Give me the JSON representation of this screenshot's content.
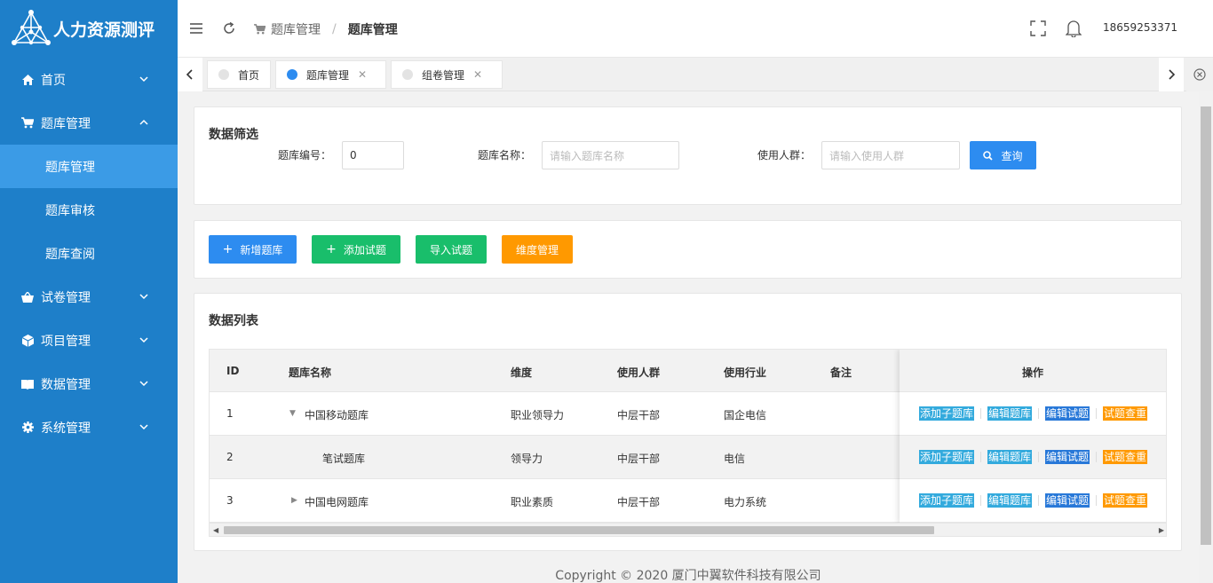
{
  "app": {
    "title": "人力资源测评"
  },
  "sidebar": {
    "items": [
      {
        "label": "首页",
        "icon": "home-icon"
      },
      {
        "label": "题库管理",
        "icon": "cart-icon",
        "expanded": true,
        "children": [
          {
            "label": "题库管理",
            "active": true
          },
          {
            "label": "题库审核"
          },
          {
            "label": "题库查阅"
          }
        ]
      },
      {
        "label": "试卷管理",
        "icon": "basket-icon"
      },
      {
        "label": "项目管理",
        "icon": "cube-icon"
      },
      {
        "label": "数据管理",
        "icon": "book-icon"
      },
      {
        "label": "系统管理",
        "icon": "gear-icon"
      }
    ]
  },
  "header": {
    "breadcrumb": [
      "题库管理",
      "题库管理"
    ],
    "user": "18659253371"
  },
  "tabs": [
    {
      "label": "首页",
      "active": false,
      "closable": false
    },
    {
      "label": "题库管理",
      "active": true,
      "closable": true
    },
    {
      "label": "组卷管理",
      "active": false,
      "closable": true
    }
  ],
  "filter": {
    "title": "数据筛选",
    "id_label": "题库编号：",
    "id_value": "0",
    "name_label": "题库名称：",
    "name_placeholder": "请输入题库名称",
    "crowd_label": "使用人群：",
    "crowd_placeholder": "请输入使用人群",
    "search_label": "查询"
  },
  "toolbar": {
    "add_bank": "新增题库",
    "add_question": "添加试题",
    "import": "导入试题",
    "dimension": "维度管理"
  },
  "table": {
    "title": "数据列表",
    "columns": [
      "ID",
      "题库名称",
      "维度",
      "使用人群",
      "使用行业",
      "备注",
      "操作"
    ],
    "rows": [
      {
        "id": "1",
        "name": "中国移动题库",
        "dimension": "职业领导力",
        "crowd": "中层干部",
        "industry": "国企电信",
        "remark": "",
        "tree": "expanded"
      },
      {
        "id": "2",
        "name": "笔试题库",
        "dimension": "领导力",
        "crowd": "中层干部",
        "industry": "电信",
        "remark": "",
        "tree": "child"
      },
      {
        "id": "3",
        "name": "中国电网题库",
        "dimension": "职业素质",
        "crowd": "中层干部",
        "industry": "电力系统",
        "remark": "",
        "tree": "collapsed"
      }
    ],
    "actions": [
      "添加子题库",
      "编辑题库",
      "编辑试题",
      "试题查重"
    ]
  },
  "colors": {
    "sidebar": "#1E7FC9",
    "active": "#3B9BE6",
    "blue": "#2D8CF0",
    "green": "#19BE6B",
    "orange": "#FF9900"
  },
  "footer": "Copyright © 2020 厦门中翼软件科技有限公司"
}
